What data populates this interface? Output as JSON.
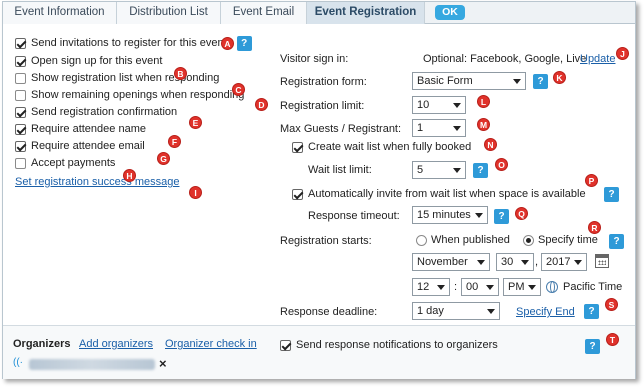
{
  "tabs": [
    {
      "label": "Event Information"
    },
    {
      "label": "Distribution List"
    },
    {
      "label": "Event Email"
    },
    {
      "label": "Event Registration",
      "active": true
    }
  ],
  "ok_label": "OK",
  "left_options": [
    {
      "label": "Send invitations to register for this event",
      "checked": true,
      "marker": "A"
    },
    {
      "label": "Open sign up for this event",
      "checked": true,
      "marker": "B"
    },
    {
      "label": "Show registration list when responding",
      "checked": false,
      "marker": "C"
    },
    {
      "label": "Show remaining openings when responding",
      "checked": false,
      "marker": "D"
    },
    {
      "label": "Send registration confirmation",
      "checked": true,
      "marker": "E"
    },
    {
      "label": "Require attendee name",
      "checked": true,
      "marker": "F"
    },
    {
      "label": "Require attendee email",
      "checked": true,
      "marker": "G"
    },
    {
      "label": "Accept payments",
      "checked": false,
      "marker": "H"
    }
  ],
  "success_message_link": "Set registration success message",
  "success_marker": "I",
  "visitor_signin": {
    "label": "Visitor sign in:",
    "value": "Optional: Facebook, Google, Live",
    "link": "Update",
    "marker": "J"
  },
  "registration_form": {
    "label": "Registration form:",
    "value": "Basic Form",
    "marker": "K"
  },
  "registration_limit": {
    "label": "Registration limit:",
    "value": "10",
    "marker": "L"
  },
  "max_guests": {
    "label": "Max Guests / Registrant:",
    "value": "1",
    "marker": "M"
  },
  "wait_list": {
    "label": "Create wait list when fully booked",
    "checked": true,
    "marker": "N"
  },
  "wait_list_limit": {
    "label": "Wait list limit:",
    "value": "5",
    "marker": "O"
  },
  "auto_invite": {
    "label": "Automatically invite from wait list when space is available",
    "checked": true,
    "marker": "P"
  },
  "response_timeout": {
    "label": "Response timeout:",
    "value": "15 minutes",
    "marker": "Q"
  },
  "registration_starts": {
    "label": "Registration starts:",
    "option_published": "When published",
    "option_specify": "Specify time",
    "selected": "specify",
    "marker": "R",
    "month": "November",
    "day": "30",
    "comma": ",",
    "year": "2017",
    "hour": "12",
    "colon": ":",
    "minute": "00",
    "ampm": "PM",
    "timezone": "Pacific Time"
  },
  "response_deadline": {
    "label": "Response deadline:",
    "value": "1 day",
    "link": "Specify End",
    "marker": "S"
  },
  "organizers": {
    "label": "Organizers",
    "add_link": "Add organizers",
    "checkin_link": "Organizer check in",
    "send_notifications": "Send response notifications to organizers",
    "send_checked": true,
    "marker": "T",
    "remove_glyph": "×"
  },
  "help_glyph": "?",
  "icons": {
    "calendar": "calendar-icon",
    "globe": "globe-icon",
    "broadcast": "broadcast-icon",
    "close": "close-icon"
  },
  "colors": {
    "accent": "#2e9ad8",
    "marker": "#e0322b",
    "link": "#1a5fa8",
    "ok": "#36a8e0"
  }
}
